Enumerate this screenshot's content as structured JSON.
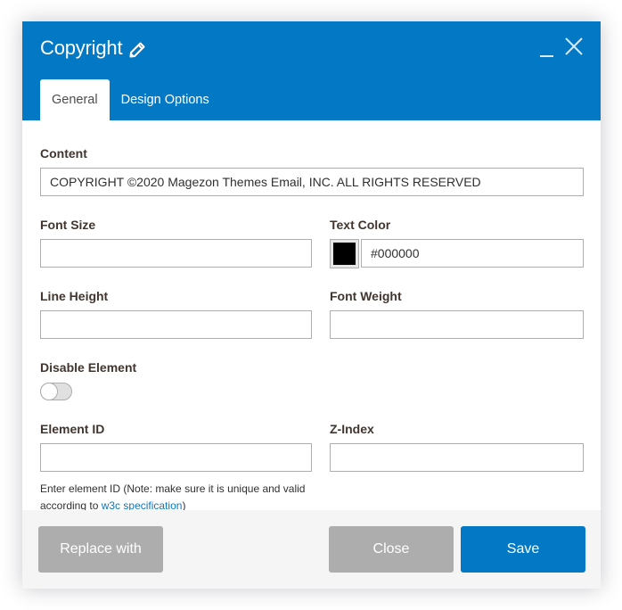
{
  "modal": {
    "title": "Copyright",
    "title_icon": "pencil-icon",
    "window_controls": [
      {
        "name": "minimize",
        "icon": "minimize-icon"
      },
      {
        "name": "close",
        "icon": "close-icon"
      }
    ],
    "tabs": [
      {
        "label": "General",
        "active": true
      },
      {
        "label": "Design Options",
        "active": false
      }
    ]
  },
  "form": {
    "content": {
      "label": "Content",
      "value": "COPYRIGHT ©2020 Magezon Themes Email, INC. ALL RIGHTS RESERVED"
    },
    "font_size": {
      "label": "Font Size",
      "value": ""
    },
    "text_color": {
      "label": "Text Color",
      "value": "#000000",
      "swatch": "#000000"
    },
    "line_height": {
      "label": "Line Height",
      "value": ""
    },
    "font_weight": {
      "label": "Font Weight",
      "value": ""
    },
    "disable_element": {
      "label": "Disable Element",
      "checked": false
    },
    "element_id": {
      "label": "Element ID",
      "value": "",
      "help_prefix": "Enter element ID (Note: make sure it is unique and valid according to ",
      "help_link": "w3c specification",
      "help_suffix": ")"
    },
    "z_index": {
      "label": "Z-Index",
      "value": ""
    }
  },
  "footer": {
    "replace_label": "Replace with",
    "close_label": "Close",
    "save_label": "Save"
  },
  "colors": {
    "primary": "#0379c6",
    "secondary_button": "#adadad",
    "footer_bg": "#f5f5f5"
  }
}
